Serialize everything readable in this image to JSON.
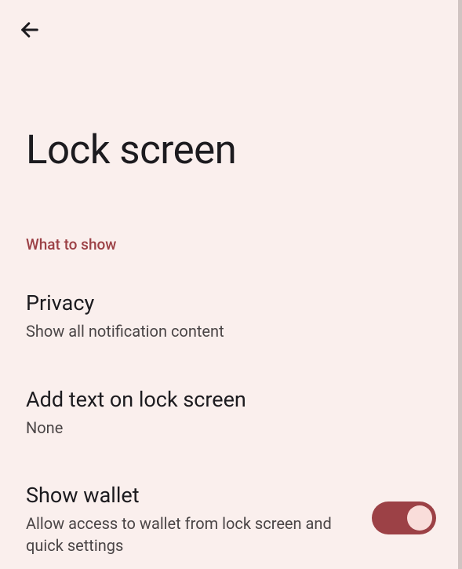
{
  "page": {
    "title": "Lock screen"
  },
  "section": {
    "header": "What to show"
  },
  "settings": {
    "privacy": {
      "title": "Privacy",
      "subtitle": "Show all notification content"
    },
    "addText": {
      "title": "Add text on lock screen",
      "subtitle": "None"
    },
    "showWallet": {
      "title": "Show wallet",
      "subtitle": "Allow access to wallet from lock screen and quick settings",
      "enabled": true
    }
  }
}
